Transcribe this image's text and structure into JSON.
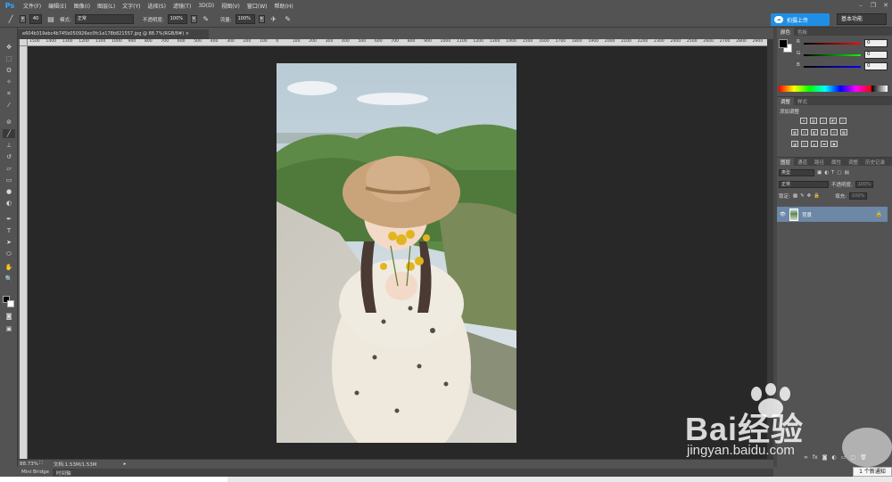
{
  "app": {
    "logo": "Ps"
  },
  "menu": [
    "文件(F)",
    "编辑(E)",
    "图像(I)",
    "图层(L)",
    "文字(Y)",
    "选择(S)",
    "滤镜(T)",
    "3D(D)",
    "视图(V)",
    "窗口(W)",
    "帮助(H)"
  ],
  "options": {
    "brush_size": "40",
    "mode_label": "模式:",
    "mode_value": "正常",
    "opacity_label": "不透明度:",
    "opacity_value": "100%",
    "flow_label": "流量:",
    "flow_value": "100%",
    "upload_label": "拍摄上传",
    "workspace": "基本功能"
  },
  "document": {
    "tab_title": "e604b319ebc4b745b050926ec0fc1e178b821557.jpg @ 88.7%(RGB/8#)",
    "ruler_ticks": [
      "1500",
      "1400",
      "1300",
      "1200",
      "1100",
      "1000",
      "900",
      "800",
      "700",
      "600",
      "500",
      "400",
      "300",
      "200",
      "100",
      "0",
      "100",
      "200",
      "300",
      "400",
      "500",
      "600",
      "700",
      "800",
      "900",
      "1000",
      "1100",
      "1200",
      "1300",
      "1400",
      "1500",
      "1600",
      "1700",
      "1800",
      "1900",
      "2000",
      "2100",
      "2200",
      "2300",
      "2400",
      "2500",
      "2600",
      "2700",
      "2800",
      "2900"
    ],
    "zoom": "88.73%",
    "doc_info": "文档:1.53M/1.53M"
  },
  "bottom_tabs": [
    "Mini Bridge",
    "时间轴"
  ],
  "color_panel": {
    "tabs": [
      "颜色",
      "色板"
    ],
    "r_label": "R",
    "g_label": "G",
    "b_label": "B",
    "r_value": "0",
    "g_value": "0",
    "b_value": "0"
  },
  "adjust_panel": {
    "tabs": [
      "调整",
      "样式"
    ],
    "title": "添加调整"
  },
  "layers_panel": {
    "tabs": [
      "图层",
      "通道",
      "路径",
      "属性",
      "调整",
      "历史记录"
    ],
    "kind_label": "类型",
    "blend_mode": "正常",
    "opacity_label": "不透明度:",
    "opacity_value": "100%",
    "lock_label": "锁定:",
    "fill_label": "填充:",
    "fill_value": "100%",
    "layer_name": "背景"
  },
  "watermark": {
    "brand": "Bai经验",
    "url": "jingyan.baidu.com"
  },
  "notification": "1 个新通知",
  "colors": {
    "accent": "#1f8fe6",
    "layer_selected": "#6d87a6",
    "canvas_bg": "#282828",
    "ui_bg": "#535353"
  }
}
